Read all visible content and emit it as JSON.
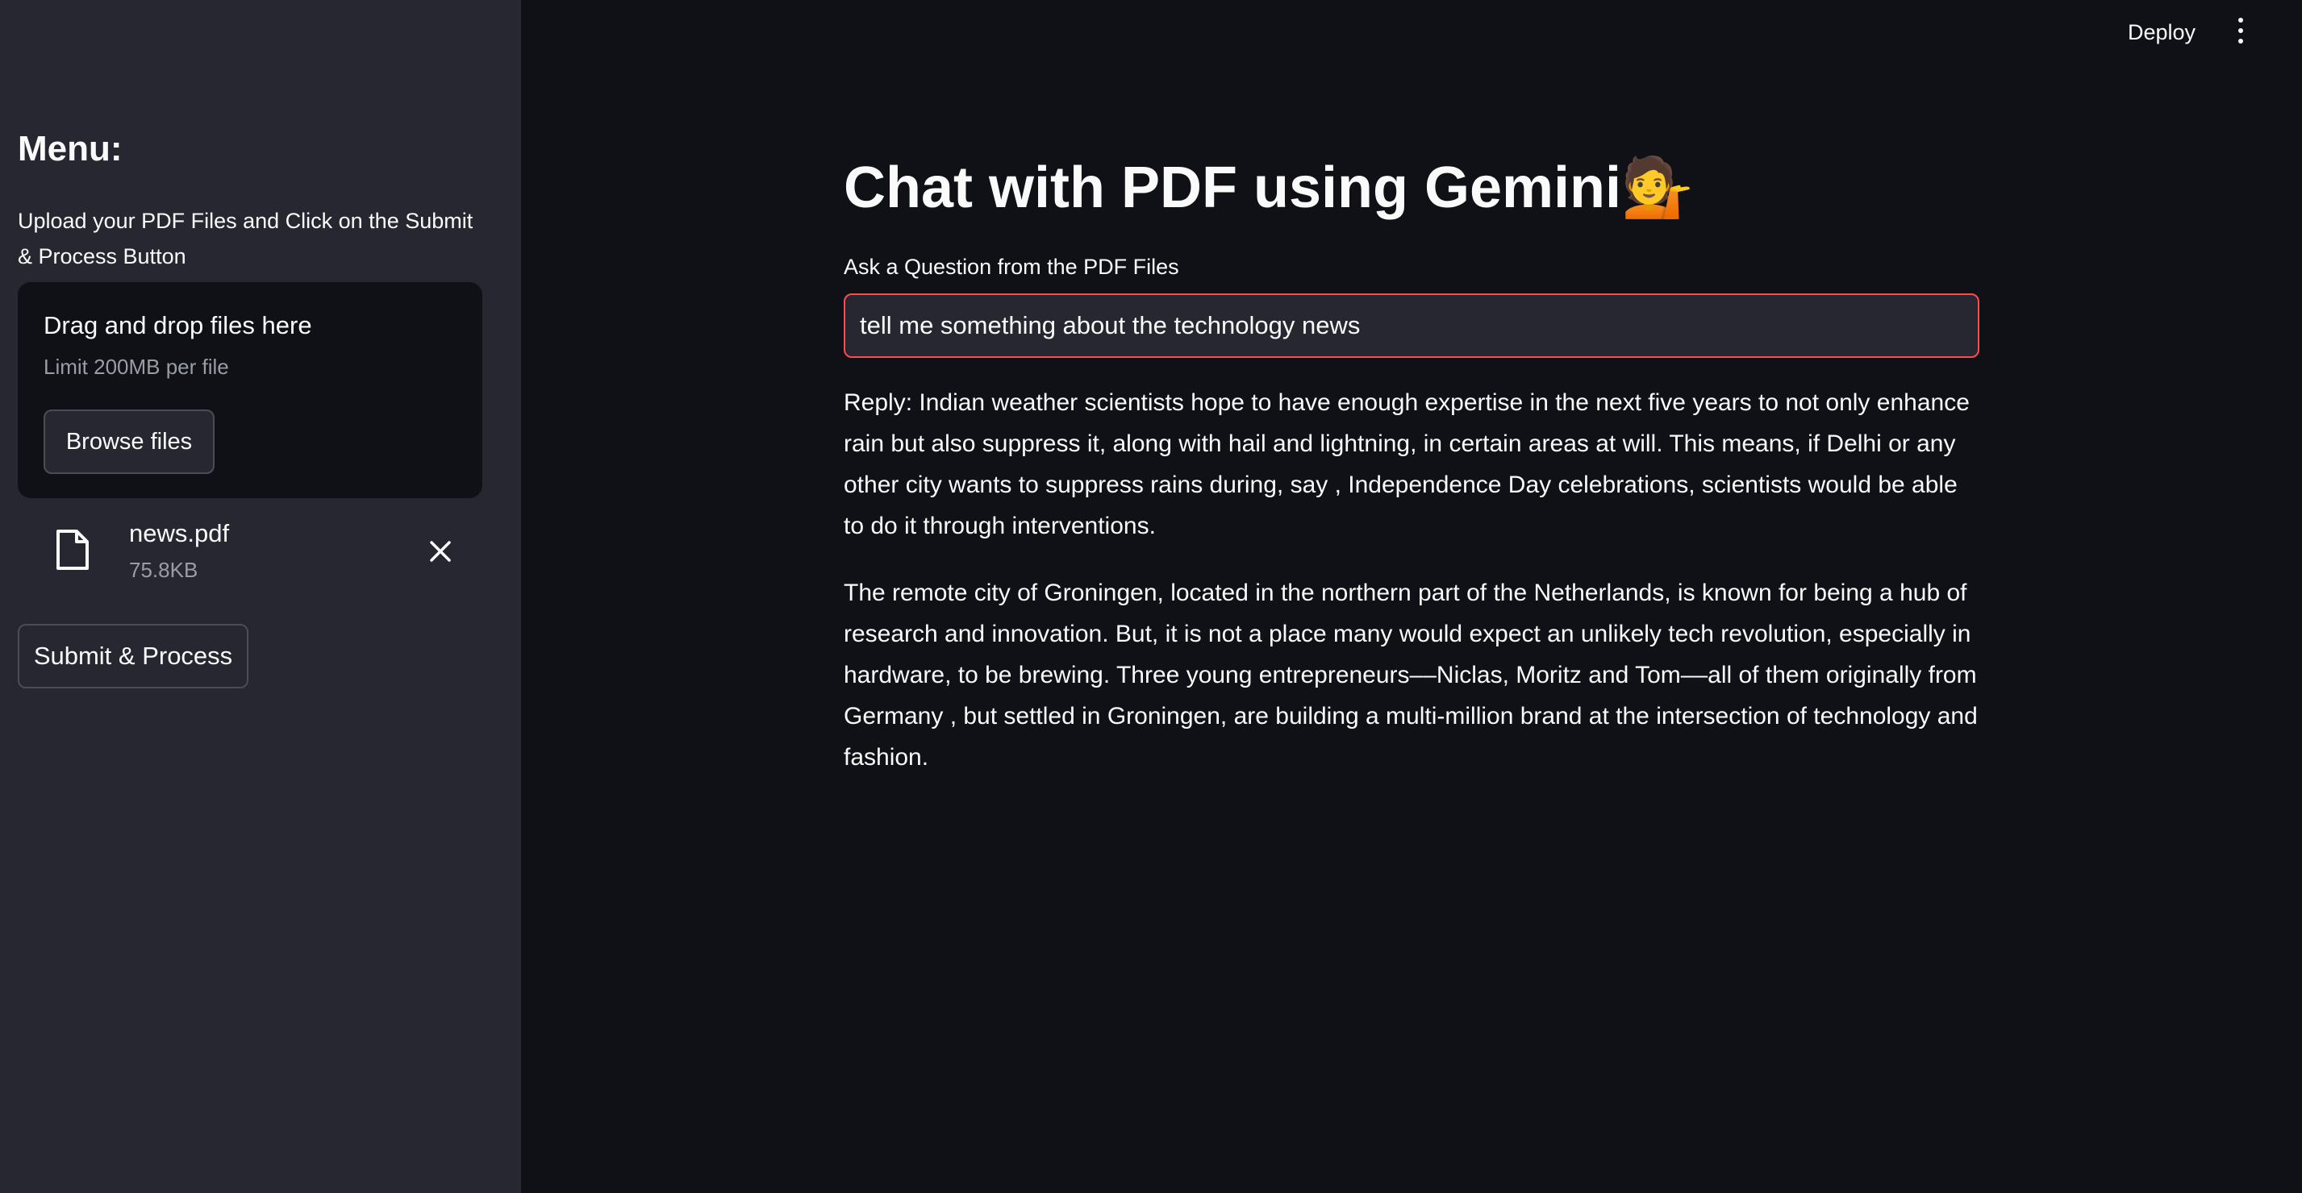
{
  "sidebar": {
    "title": "Menu:",
    "upload_instructions": "Upload your PDF Files and Click on the Submit & Process Button",
    "dropzone": {
      "title": "Drag and drop files here",
      "limit": "Limit 200MB per file",
      "browse_label": "Browse files"
    },
    "uploaded_file": {
      "name": "news.pdf",
      "size": "75.8KB",
      "icon": "file-icon",
      "remove_icon": "close-icon"
    },
    "submit_label": "Submit & Process"
  },
  "header": {
    "deploy_label": "Deploy",
    "menu_icon": "kebab-menu-icon"
  },
  "main": {
    "title": "Chat with PDF using Gemini💁",
    "question_label": "Ask a Question from the PDF Files",
    "question_value": "tell me something about the technology news",
    "reply_paragraphs": [
      "Reply: Indian weather scientists hope to have enough expertise in the next five years to not only enhance rain but also suppress it, along with hail and lightning, in certain areas at will. This means, if Delhi or any other city wants to suppress rains during, say , Independence Day celebrations, scientists would be able to do it through interventions.",
      "The remote city of Groningen, located in the northern part of the Netherlands, is known for being a hub of research and innovation. But, it is not a place many would expect an unlikely tech revolution, especially in hardware, to be brewing. Three young entrepreneurs––Niclas, Moritz and Tom––all of them originally from Germany , but settled in Groningen, are building a multi-million brand at the intersection of technology and fashion."
    ]
  },
  "colors": {
    "background": "#0f1117",
    "sidebar": "#262730",
    "accent_focus": "#ff4b4b",
    "muted_text": "#9a9ca6"
  }
}
